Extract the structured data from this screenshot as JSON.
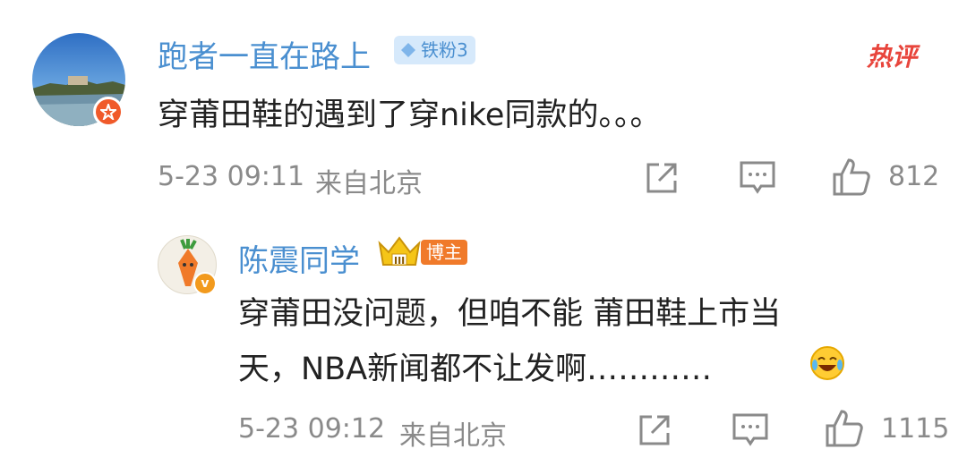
{
  "comment": {
    "username": "跑者一直在路上",
    "fan_badge": "铁粉3",
    "hot_label": "热评",
    "text": "穿莆田鞋的遇到了穿nike同款的。。。",
    "time": "5-23 09:11",
    "location": "来自北京",
    "like_count": "812"
  },
  "reply": {
    "username": "陈震同学",
    "badge_level": "III",
    "badge_label": "博主",
    "text_line1": "穿莆田没问题，但咱不能 莆田鞋上市当",
    "text_line2": "天，NBA新闻都不让发啊…………",
    "time": "5-23 09:12",
    "location": "来自北京",
    "like_count": "1115"
  },
  "colors": {
    "username": "#4a8fd0",
    "hot": "#e8453c",
    "blogger_badge": "#f07a2a",
    "meta": "#8a8a8a"
  },
  "icons": {
    "share": "share-icon",
    "comment": "comment-icon",
    "like": "thumbs-up-icon",
    "verified": "verified-badge-icon",
    "emoji": "laughing-crying-emoji-icon",
    "crown": "crown-icon",
    "diamond": "diamond-icon"
  }
}
